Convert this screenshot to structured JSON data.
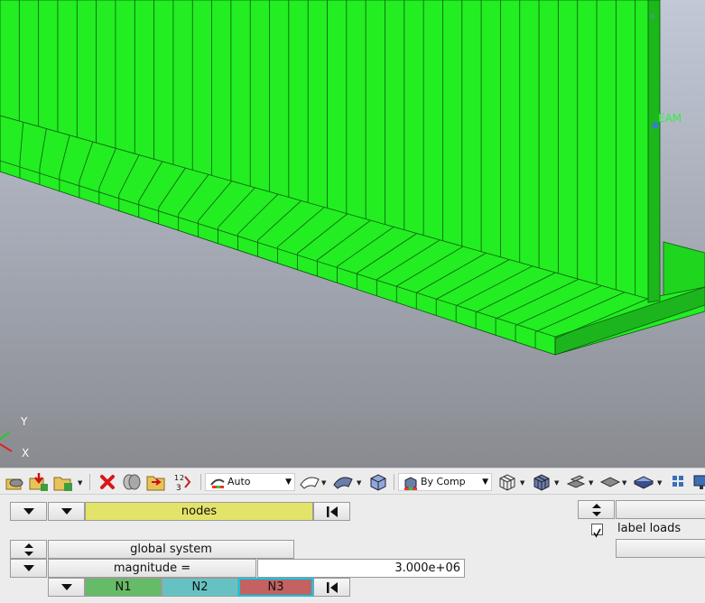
{
  "viewport": {
    "axis_y_label": "Y",
    "axis_x_label": "X",
    "beam_label": "EAM"
  },
  "toolbar": {
    "icons": [
      "model-browser-icon",
      "import-icon",
      "open-folder-icon",
      "delete-icon",
      "mask-icon",
      "show-folder-icon",
      "renumber-icon",
      "mesh-display-icon",
      "curved-surface-icon",
      "solid-surface-icon",
      "cube-icon",
      "component-color-icon",
      "wireframe-icon",
      "shaded-cube-icon",
      "element-edges-icon",
      "shell-icon",
      "solid-icon",
      "grid-icon",
      "monitor-icon"
    ],
    "auto_label": "Auto",
    "bycomp_label": "By Comp"
  },
  "panel": {
    "nodes_label": "nodes",
    "global_system_label": "global system",
    "magnitude_label": "magnitude =",
    "magnitude_value": "3.000e+06",
    "n1_label": "N1",
    "n2_label": "N2",
    "n3_label": "N3",
    "label_loads_label": "label loads",
    "label_loads_checked": true
  },
  "colors": {
    "mesh_green": "#22ee22",
    "nodes_yellow": "#e3e36a",
    "n1_green": "#66bb66",
    "n2_teal": "#66c2c2",
    "n3_red": "#c46262",
    "n3_border": "#00c8e8"
  }
}
